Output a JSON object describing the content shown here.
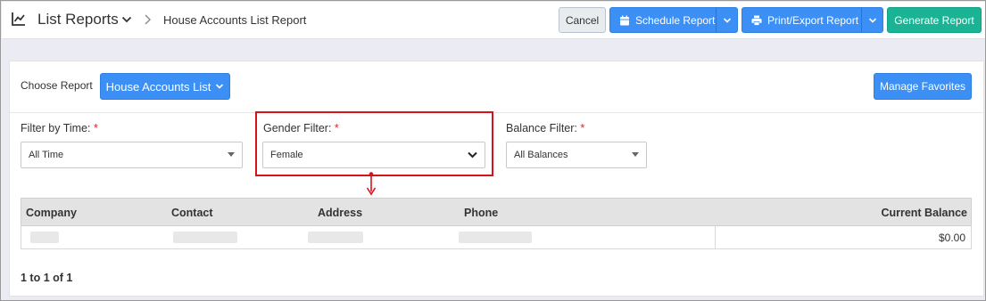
{
  "header": {
    "title": "List Reports",
    "breadcrumb": "House Accounts List Report",
    "cancel_label": "Cancel",
    "schedule_label": "Schedule Report",
    "print_label": "Print/Export Report",
    "generate_label": "Generate Report"
  },
  "report_picker": {
    "label": "Choose Report",
    "selected": "House Accounts List",
    "manage_favorites_label": "Manage Favorites"
  },
  "filters": {
    "time": {
      "label": "Filter by Time:",
      "required_mark": "*",
      "value": "All Time"
    },
    "gender": {
      "label": "Gender Filter:",
      "required_mark": "*",
      "value": "Female"
    },
    "balance": {
      "label": "Balance Filter:",
      "required_mark": "*",
      "value": "All Balances"
    }
  },
  "table": {
    "columns": [
      "Company",
      "Contact",
      "Address",
      "Phone",
      "Current Balance"
    ],
    "rows": [
      {
        "current_balance": "$0.00"
      }
    ]
  },
  "pagination": "1 to 1 of 1",
  "colors": {
    "primary_blue": "#3b8ff5",
    "generate_green": "#1ab394",
    "highlight_red": "#d6121a",
    "required_red": "#e02424"
  },
  "icons": [
    "chart-line-icon",
    "chevron-down-icon",
    "chevron-right-icon",
    "calendar-icon",
    "printer-icon",
    "caret-down-icon",
    "arrow-down-icon"
  ]
}
